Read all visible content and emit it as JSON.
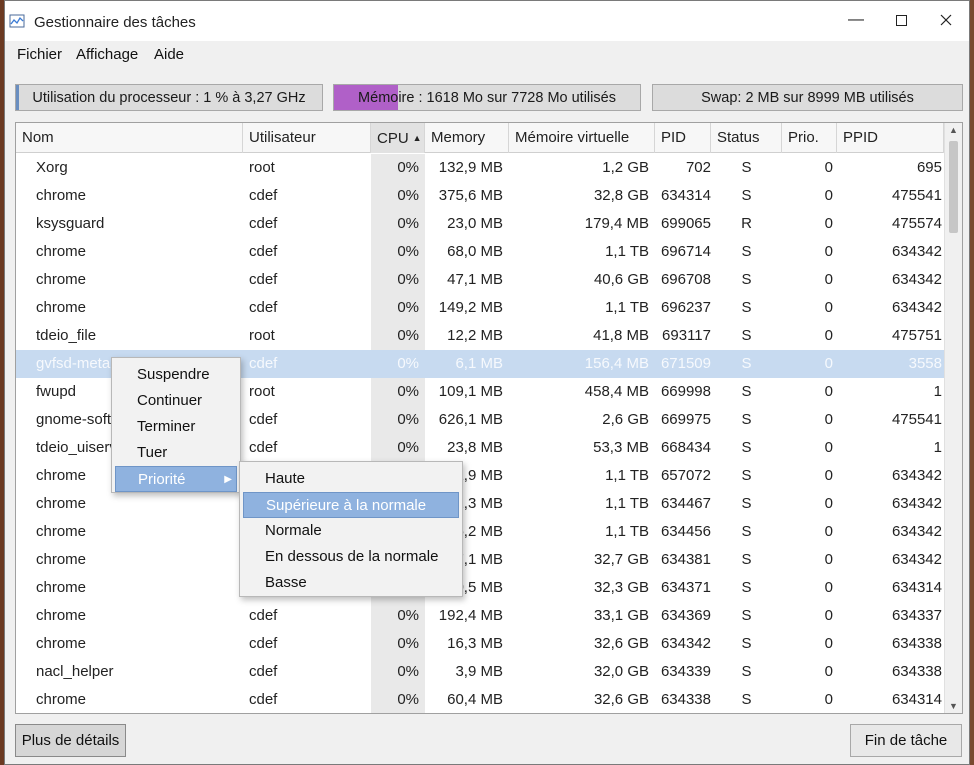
{
  "window": {
    "title": "Gestionnaire des tâches"
  },
  "menubar": {
    "items": [
      "Fichier",
      "Affichage",
      "Aide"
    ]
  },
  "stats": {
    "cpu": {
      "label": "Utilisation du processeur : 1 % à 3,27 GHz",
      "fill_fraction": 0.01
    },
    "memory": {
      "label": "Mémoire : 1618 Mo sur 7728 Mo utilisés",
      "fill_fraction": 0.21,
      "fill_color": "#b060c8"
    },
    "swap": {
      "label": "Swap: 2 MB sur 8999 MB utilisés",
      "fill_fraction": 0.0
    }
  },
  "table": {
    "columns": [
      "Nom",
      "Utilisateur",
      "CPU",
      "Memory",
      "Mémoire virtuelle",
      "PID",
      "Status",
      "Prio.",
      "PPID"
    ],
    "sorted_column": "CPU",
    "rows": [
      [
        "Xorg",
        "root",
        "0%",
        "132,9 MB",
        "1,2 GB",
        "702",
        "S",
        "0",
        "695"
      ],
      [
        "chrome",
        "cdef",
        "0%",
        "375,6 MB",
        "32,8 GB",
        "634314",
        "S",
        "0",
        "475541"
      ],
      [
        "ksysguard",
        "cdef",
        "0%",
        "23,0 MB",
        "179,4 MB",
        "699065",
        "R",
        "0",
        "475574"
      ],
      [
        "chrome",
        "cdef",
        "0%",
        "68,0 MB",
        "1,1 TB",
        "696714",
        "S",
        "0",
        "634342"
      ],
      [
        "chrome",
        "cdef",
        "0%",
        "47,1 MB",
        "40,6 GB",
        "696708",
        "S",
        "0",
        "634342"
      ],
      [
        "chrome",
        "cdef",
        "0%",
        "149,2 MB",
        "1,1 TB",
        "696237",
        "S",
        "0",
        "634342"
      ],
      [
        "tdeio_file",
        "root",
        "0%",
        "12,2 MB",
        "41,8 MB",
        "693117",
        "S",
        "0",
        "475751"
      ],
      [
        "gvfsd-meta",
        "cdef",
        "0%",
        "6,1 MB",
        "156,4 MB",
        "671509",
        "S",
        "0",
        "3558"
      ],
      [
        "fwupd",
        "root",
        "0%",
        "109,1 MB",
        "458,4 MB",
        "669998",
        "S",
        "0",
        "1"
      ],
      [
        "gnome-soft",
        "cdef",
        "0%",
        "626,1 MB",
        "2,6 GB",
        "669975",
        "S",
        "0",
        "475541"
      ],
      [
        "tdeio_uiserv",
        "cdef",
        "0%",
        "23,8 MB",
        "53,3 MB",
        "668434",
        "S",
        "0",
        "1"
      ],
      [
        "chrome",
        "",
        "",
        "1,9 MB",
        "1,1 TB",
        "657072",
        "S",
        "0",
        "634342"
      ],
      [
        "chrome",
        "",
        "",
        "2,3 MB",
        "1,1 TB",
        "634467",
        "S",
        "0",
        "634342"
      ],
      [
        "chrome",
        "",
        "",
        "5,2 MB",
        "1,1 TB",
        "634456",
        "S",
        "0",
        "634342"
      ],
      [
        "chrome",
        "",
        "",
        "7,1 MB",
        "32,7 GB",
        "634381",
        "S",
        "0",
        "634342"
      ],
      [
        "chrome",
        "",
        "",
        "0,5 MB",
        "32,3 GB",
        "634371",
        "S",
        "0",
        "634314"
      ],
      [
        "chrome",
        "cdef",
        "0%",
        "192,4 MB",
        "33,1 GB",
        "634369",
        "S",
        "0",
        "634337"
      ],
      [
        "chrome",
        "cdef",
        "0%",
        "16,3 MB",
        "32,6 GB",
        "634342",
        "S",
        "0",
        "634338"
      ],
      [
        "nacl_helper",
        "cdef",
        "0%",
        "3,9 MB",
        "32,0 GB",
        "634339",
        "S",
        "0",
        "634338"
      ],
      [
        "chrome",
        "cdef",
        "0%",
        "60,4 MB",
        "32,6 GB",
        "634338",
        "S",
        "0",
        "634314"
      ]
    ],
    "selected_row": 7
  },
  "context_menu": {
    "items": [
      "Suspendre",
      "Continuer",
      "Terminer",
      "Tuer",
      "Priorité"
    ],
    "active": "Priorité"
  },
  "priority_submenu": {
    "items": [
      "Haute",
      "Supérieure à la normale",
      "Normale",
      "En dessous de la normale",
      "Basse"
    ],
    "active": "Supérieure à la normale"
  },
  "footer": {
    "details_label": "Plus de détails",
    "end_task_label": "Fin de tâche"
  },
  "colors": {
    "selection": "#c7daf0",
    "menu_highlight": "#8fb2df",
    "memory_fill": "#b060c8",
    "cpu_fill": "#6a8ec0"
  }
}
